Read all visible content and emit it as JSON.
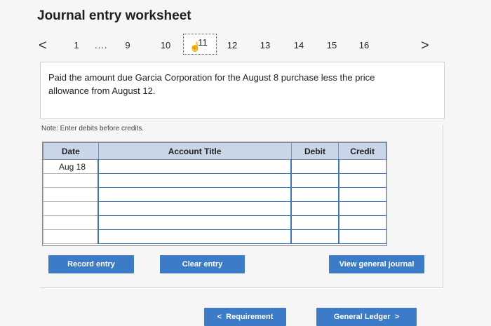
{
  "title": "Journal entry worksheet",
  "pager": {
    "prev": "<",
    "next": ">",
    "pages": [
      "1",
      "9",
      "10",
      "11",
      "12",
      "13",
      "14",
      "15",
      "16"
    ],
    "ellipsis": "....",
    "active": "11"
  },
  "question": "Paid the amount due Garcia Corporation for the August 8 purchase less the price allowance from August 12.",
  "note": "Note: Enter debits before credits.",
  "table": {
    "headers": [
      "Date",
      "Account Title",
      "Debit",
      "Credit"
    ],
    "first_date": "Aug 18"
  },
  "buttons": {
    "record": "Record entry",
    "clear": "Clear entry",
    "view": "View general journal",
    "requirement": "Requirement",
    "requirement_chevron": "<",
    "ledger": "General Ledger",
    "ledger_chevron": ">"
  },
  "colors": {
    "button": "#3c7bc8",
    "header": "#c9d6e8"
  }
}
